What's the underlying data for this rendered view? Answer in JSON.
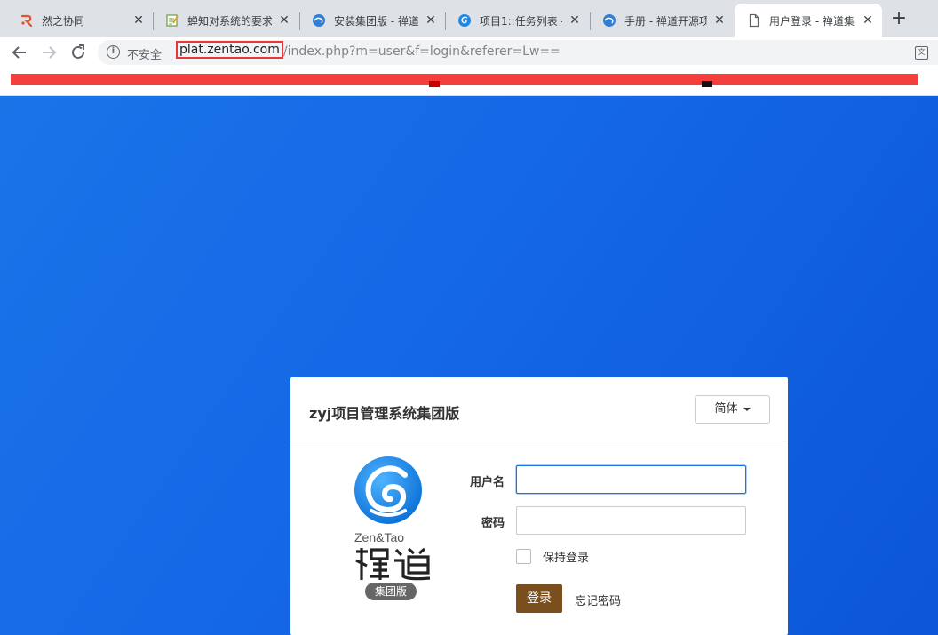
{
  "browser": {
    "tabs": [
      {
        "title": "然之协同",
        "icon": "ranzhi-icon"
      },
      {
        "title": "蝉知对系统的要求",
        "icon": "notepad-icon"
      },
      {
        "title": "安装集团版 - 禅道",
        "icon": "zentao-globe-icon"
      },
      {
        "title": "项目1::任务列表 - ",
        "icon": "zentao-swirl-icon"
      },
      {
        "title": "手册 - 禅道开源项",
        "icon": "zentao-globe-icon"
      },
      {
        "title": "用户登录 - 禅道集",
        "icon": "page-icon"
      }
    ],
    "active_tab": 5,
    "address": {
      "security_label": "不安全",
      "domain": "plat.zentao.com",
      "path": "/index.php?m=user&f=login&referer=Lw=="
    }
  },
  "login": {
    "title": "zyj项目管理系统集团版",
    "language": "简体",
    "logo_text": "Zen&Tao",
    "edition_badge": "集团版",
    "username_label": "用户名",
    "username_value": "",
    "password_label": "密码",
    "password_value": "",
    "remember_label": "保持登录",
    "remember_checked": false,
    "submit_label": "登录",
    "forgot_label": "忘记密码"
  },
  "colors": {
    "page_background": "#1466e6",
    "submit_button": "#7a4f1d",
    "redaction": "#f43f3f",
    "url_highlight": "#e53935"
  }
}
